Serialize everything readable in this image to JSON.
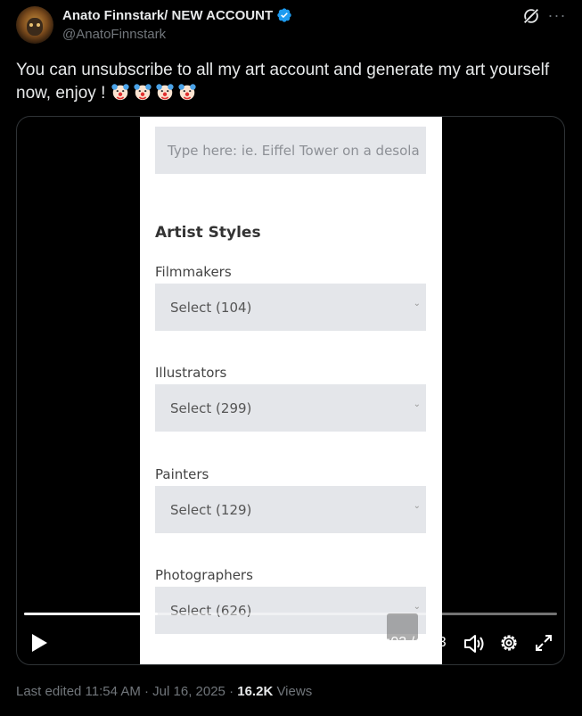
{
  "author": {
    "display_name": "Anato Finnstark/ NEW ACCOUNT",
    "handle": "@AnatoFinnstark",
    "verified": true
  },
  "header_icons": [
    "grok-icon",
    "more-icon"
  ],
  "tweet": {
    "text": "You can unsubscribe to all my art account and generate my art yourself now, enjoy !",
    "emojis": [
      "clown-face",
      "clown-face",
      "clown-face",
      "clown-face"
    ]
  },
  "video_frame": {
    "prompt_placeholder": "Type here: ie. Eiffel Tower on a desola",
    "section_heading": "Artist Styles",
    "fields": [
      {
        "label": "Filmmakers",
        "value": "Select (104)"
      },
      {
        "label": "Illustrators",
        "value": "Select (299)"
      },
      {
        "label": "Painters",
        "value": "Select (129)"
      },
      {
        "label": "Photographers",
        "value": "Select (626)"
      }
    ]
  },
  "player": {
    "time_current": "0:03",
    "time_total": "0:13",
    "progress": 0.25,
    "controls": [
      "play-icon",
      "volume-icon",
      "settings-icon",
      "fullscreen-icon"
    ]
  },
  "meta": {
    "edited_label": "Last edited 11:54 AM",
    "separator": " · ",
    "date": "Jul 16, 2025",
    "views_count": "16.2K",
    "views_label": " Views"
  },
  "colors": {
    "background": "#000000",
    "text_primary": "#e7e9ea",
    "text_secondary": "#71767b",
    "verified_blue": "#1d9bf0",
    "field_bg": "#e4e6ea"
  }
}
